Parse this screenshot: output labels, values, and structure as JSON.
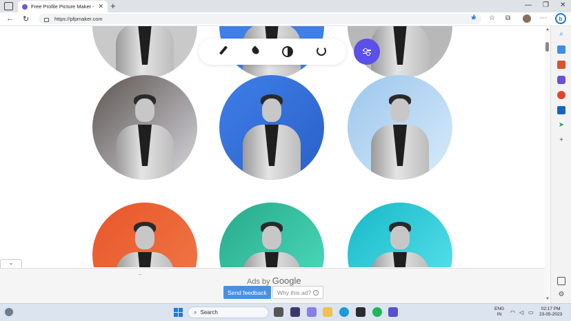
{
  "browser": {
    "tab_title": "Free Profile Picture Maker - Resu",
    "tab_close": "✕",
    "new_tab": "+",
    "window_min": "—",
    "window_max": "❐",
    "window_close": "✕",
    "back": "←",
    "reload": "↻",
    "url": "https://pfpmaker.com",
    "read_aloud": "Á",
    "favorite": "★",
    "favorites": "☆",
    "collections": "⧉",
    "more": "⋯",
    "bing": "b"
  },
  "page": {
    "toolbar": {
      "tools": [
        "pencil-icon",
        "drop-icon",
        "contrast-icon",
        "reset-icon"
      ],
      "filter_icon": "sliders-icon",
      "accent_color": "#5b50e8"
    },
    "backgrounds": [
      {
        "color_a": "#5c5450",
        "color_b": "#d8d8e0"
      },
      {
        "color_a": "#3f7fe8",
        "color_b": "#2a5fc8"
      },
      {
        "color_a": "#9cc6ec",
        "color_b": "#d8ebfa"
      },
      {
        "color_a": "#e8562a",
        "color_b": "#f07a48"
      },
      {
        "color_a": "#27a98a",
        "color_b": "#4fe0c0"
      },
      {
        "color_a": "#17b8c8",
        "color_b": "#5ee6ef"
      }
    ]
  },
  "ad": {
    "ads_by": "Ads by",
    "google": "Google",
    "feedback": "Send feedback",
    "why_ad": "Why this ad?",
    "info": "i",
    "back": "←",
    "collapse": "⌄"
  },
  "sidebar": {
    "icons": [
      "search-icon",
      "tag-icon",
      "briefcase-icon",
      "chess-icon",
      "office-icon",
      "outlook-icon",
      "send-icon",
      "add-icon",
      "split-screen-icon",
      "settings-icon"
    ],
    "add": "+",
    "settings": "⚙"
  },
  "taskbar": {
    "search": "Search",
    "language": "ENG",
    "region": "IN",
    "time": "02:17 PM",
    "date": "23-05-2023",
    "apps": [
      "file-explorer-icon",
      "terminal-icon",
      "folder-icon",
      "edge-icon",
      "sticky-icon",
      "spotify-icon",
      "vscode-icon"
    ]
  }
}
